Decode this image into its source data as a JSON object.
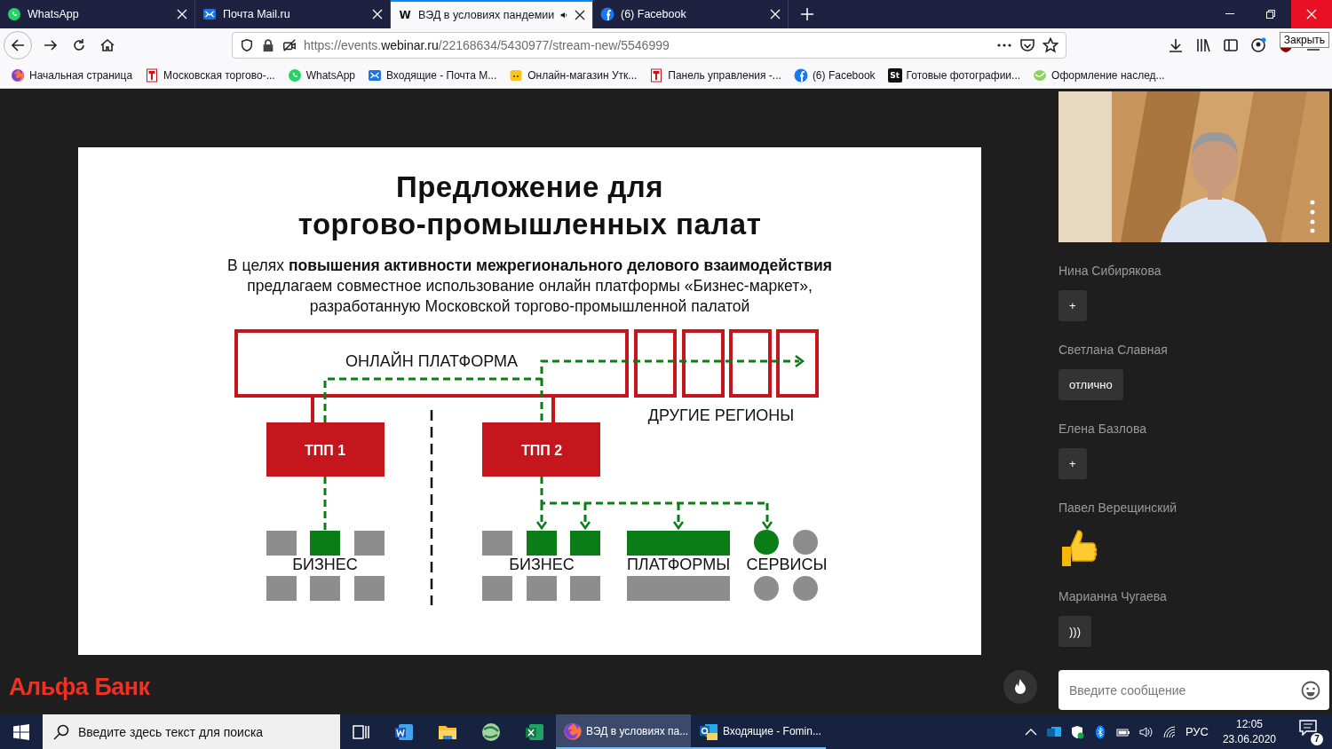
{
  "browser": {
    "tabs": [
      {
        "title": "WhatsApp",
        "kind": "chat",
        "selected": false,
        "audio": false
      },
      {
        "title": "Почта Mail.ru",
        "kind": "mail",
        "selected": false,
        "audio": false
      },
      {
        "title": "ВЭД в условиях пандемии",
        "kind": "letter",
        "glyph": "W",
        "selected": true,
        "audio": true
      },
      {
        "title": "(6) Facebook",
        "kind": "social",
        "selected": false,
        "audio": false
      }
    ],
    "address": {
      "scheme": "https://events.",
      "domain": "webinar.ru",
      "path": "/22168634/5430977/stream-new/5546999"
    },
    "tooltip": "Закрыть",
    "bookmarks": [
      {
        "title": "Начальная страница",
        "kind": "browser"
      },
      {
        "title": "Московская торгово-...",
        "kind": "document"
      },
      {
        "title": "WhatsApp",
        "kind": "chat"
      },
      {
        "title": "Входящие - Почта М...",
        "kind": "mail"
      },
      {
        "title": "Онлайн-магазин Утк...",
        "kind": "shop"
      },
      {
        "title": "Панель управления -...",
        "kind": "document"
      },
      {
        "title": "(6) Facebook",
        "kind": "social"
      },
      {
        "title": "Готовые фотографии...",
        "kind": "letter",
        "glyph": "St"
      },
      {
        "title": "Оформление наслед...",
        "kind": "leaf"
      }
    ]
  },
  "slide": {
    "title_lines": [
      "Предложение для",
      "торгово-промышленных палат"
    ],
    "intro_lines": [
      "В целях **повышения активности межрегионального делового взаимодействия**",
      "предлагаем совместное использование онлайн платформы «Бизнес-маркет»,",
      "разработанную Московской торгово-промышленной палатой"
    ],
    "diagram": {
      "platform": "ОНЛАЙН ПЛАТФОРМА",
      "regions": "ДРУГИЕ РЕГИОНЫ",
      "chambers": [
        "ТПП 1",
        "ТПП 2"
      ],
      "groups": [
        "БИЗНЕС",
        "БИЗНЕС",
        "ПЛАТФОРМЫ",
        "СЕРВИСЫ"
      ]
    }
  },
  "logo": "Альфа Банк",
  "chat": {
    "messages": [
      {
        "author": "Нина Сибирякова",
        "kind": "text",
        "text": "+"
      },
      {
        "author": "Светлана Славная",
        "kind": "text",
        "text": "отлично"
      },
      {
        "author": "Елена Базлова",
        "kind": "text",
        "text": "+"
      },
      {
        "author": "Павел Верещинский",
        "kind": "thumbs-up"
      },
      {
        "author": "Марианна Чугаева",
        "kind": "text",
        "text": ")))"
      }
    ],
    "input": {
      "placeholder": "Введите сообщение"
    }
  },
  "taskbar": {
    "search_placeholder": "Введите здесь текст для поиска",
    "pinned": [
      {
        "kind": "task-view"
      },
      {
        "kind": "word"
      },
      {
        "kind": "folder"
      },
      {
        "kind": "globe"
      },
      {
        "kind": "excel"
      }
    ],
    "windows": [
      {
        "title": "ВЭД в условиях па...",
        "kind": "browser",
        "selected": true
      },
      {
        "title": "Входящие - Fomin...",
        "kind": "mail-app",
        "selected": false
      }
    ],
    "language": "РУС",
    "time": "12:05",
    "date": "23.06.2020",
    "notifications": "7"
  }
}
